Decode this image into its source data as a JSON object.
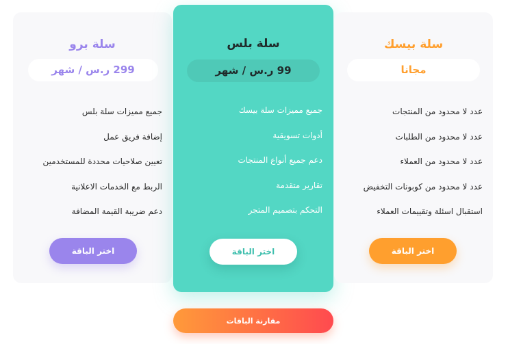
{
  "colors": {
    "basic_accent": "#ff9f2e",
    "plus_bg": "#53d7c4",
    "plus_pill": "#4fc9b7",
    "pro_accent": "#9a85ec",
    "card_bg": "#f8f8fa",
    "text_dark": "#2a2a2a"
  },
  "plans": {
    "basic": {
      "title": "سلة بيسك",
      "price": "مجانا",
      "features": [
        "عدد لا محدود من المنتجات",
        "عدد لا محدود من الطلبات",
        "عدد لا محدود من العملاء",
        "عدد لا محدود من كوبونات التخفيض",
        "استقبال اسئلة وتقييمات العملاء"
      ],
      "cta": "اختر الباقة"
    },
    "plus": {
      "title": "سلة بلس",
      "price": "99 ر.س / شهر",
      "features": [
        "جميع مميزات سلة بيسك",
        "أدوات تسويقية",
        "دعم جميع أنواع المنتجات",
        "تقارير متقدمة",
        "التحكم بتصميم المتجر"
      ],
      "cta": "اختر الباقة"
    },
    "pro": {
      "title": "سلة برو",
      "price": "299 ر.س / شهر",
      "features": [
        "جميع مميزات سلة بلس",
        "إضافة فريق عمل",
        "تعيين صلاحيات محددة للمستخدمين",
        "الربط مع الخدمات الاعلانية",
        "دعم ضريبة القيمة المضافة"
      ],
      "cta": "اختر الباقة"
    }
  },
  "compare_label": "مقارنة الباقات"
}
